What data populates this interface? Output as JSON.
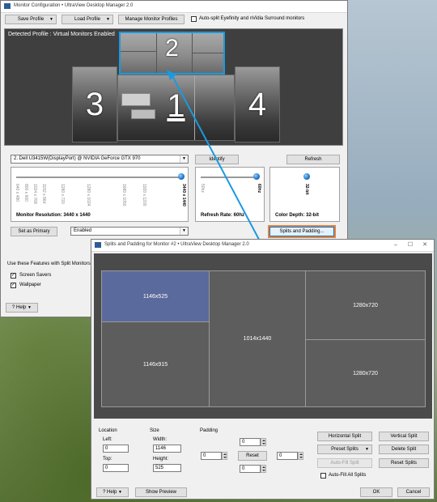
{
  "window1": {
    "title": "Monitor Configuration • UltraView Desktop Manager 2.0",
    "toolbar": {
      "save_profile": "Save Profile",
      "load_profile": "Load Profile",
      "manage_profiles": "Manage Monitor Profiles",
      "autosplit_label": "Auto-split Eyefinity and nVidia Surround monitors"
    },
    "detected_profile": "Detected Profile : Virtual Monitors Enabled",
    "monitors": [
      {
        "number": "2"
      },
      {
        "number": "3"
      },
      {
        "number": "1"
      },
      {
        "number": "4"
      }
    ],
    "monitor_select": "2. Dell U3415W(DisplayPort) @ NVIDIA GeForce GTX 970",
    "identify": "Identify",
    "refresh": "Refresh",
    "resolution": {
      "ticks": [
        "640 x 480",
        "800 x 600",
        "1024 x 768",
        "1152 x 864",
        "1280 x 720",
        "1280 x 1024",
        "1680 x 1050",
        "1920 x 1200"
      ],
      "current_tick": "3440 x 1440",
      "label": "Monitor Resolution: 3440 x 1440"
    },
    "refresh_rate": {
      "ticks": [
        "50hz"
      ],
      "current_tick": "60hz",
      "label": "Refresh Rate: 60hz"
    },
    "color_depth": {
      "current_tick": "32-bit",
      "label": "Color Depth: 32-bit"
    },
    "set_primary": "Set as Primary",
    "enabled_select": "Enabled",
    "splits_padding": "Splits and Padding...",
    "features_heading": "Use these Features with Split Monitors",
    "screen_savers": "Screen Savers",
    "wallpaper": "Wallpaper",
    "help": "Help"
  },
  "window2": {
    "title": "Splits and Padding for Monitor #2 • UltraView Desktop Manager 2.0",
    "regions": [
      "1146x525",
      "1146x915",
      "1014x1440",
      "1280x720",
      "1280x720"
    ],
    "location": {
      "heading": "Location",
      "left_label": "Left:",
      "left_value": "0",
      "top_label": "Top:",
      "top_value": "0"
    },
    "size": {
      "heading": "Size",
      "width_label": "Width:",
      "width_value": "1146",
      "height_label": "Height:",
      "height_value": "525"
    },
    "padding": {
      "heading": "Padding",
      "top": "0",
      "left": "0",
      "right": "0",
      "bottom": "0",
      "reset": "Reset"
    },
    "buttons": {
      "horizontal_split": "Horizontal Split",
      "vertical_split": "Vertical Split",
      "preset_splits": "Preset Splits",
      "delete_split": "Delete Split",
      "auto_fill_split": "Auto-Fill Split",
      "reset_splits": "Reset Splits",
      "auto_fill_all": "Auto-Fill All Splits"
    },
    "help": "Help",
    "show_preview": "Show Preview",
    "ok": "OK",
    "cancel": "Cancel"
  },
  "colors": {
    "accent_arrow": "#1a9ae0",
    "selected_region": "#5b6a9c",
    "highlight_button": "#e8833a"
  }
}
